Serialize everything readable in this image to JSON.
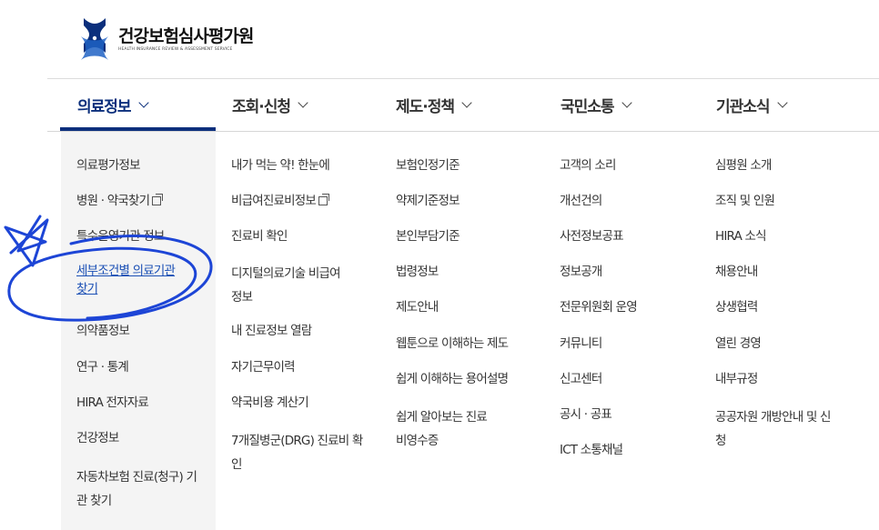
{
  "brand": {
    "name": "건강보험심사평가원",
    "subtitle": "HEALTH INSURANCE REVIEW & ASSESSMENT SERVICE",
    "colors": {
      "navy": "#0b2f7c",
      "blue": "#1e62c4"
    }
  },
  "nav": [
    {
      "label": "의료정보",
      "active": true
    },
    {
      "label": "조회·신청"
    },
    {
      "label": "제도·정책"
    },
    {
      "label": "국민소통"
    },
    {
      "label": "기관소식"
    }
  ],
  "menus": {
    "col1": [
      "의료평가정보",
      "병원 · 약국찾기",
      "특수운영기관 정보",
      "세부조건별 의료기관 찾기",
      "의약품정보",
      "연구 · 통계",
      "HIRA 전자자료",
      "건강정보",
      "자동차보험 진료(청구) 기관 찾기"
    ],
    "col2": [
      "내가 먹는 약! 한눈에",
      "비급여진료비정보",
      "진료비 확인",
      "디지털의료기술 비급여정보",
      "내 진료정보 열람",
      "자기근무이력",
      "약국비용 계산기",
      "7개질병군(DRG) 진료비 확인"
    ],
    "col3": [
      "보험인정기준",
      "약제기준정보",
      "본인부담기준",
      "법령정보",
      "제도안내",
      "웹툰으로 이해하는 제도",
      "쉽게 이해하는 용어설명",
      "쉽게 알아보는 진료비영수증"
    ],
    "col4": [
      "고객의 소리",
      "개선건의",
      "사전정보공표",
      "정보공개",
      "전문위원회 운영",
      "커뮤니티",
      "신고센터",
      "공시 · 공표",
      "ICT 소통채널"
    ],
    "col5": [
      "심평원 소개",
      "조직 및 인원",
      "HIRA 소식",
      "채용안내",
      "상생협력",
      "열린 경영",
      "내부규정",
      "공공자원 개방안내 및 신청"
    ]
  },
  "annotation": {
    "color": "#1d45d6",
    "kind": "hand-drawn-circle-and-star"
  }
}
